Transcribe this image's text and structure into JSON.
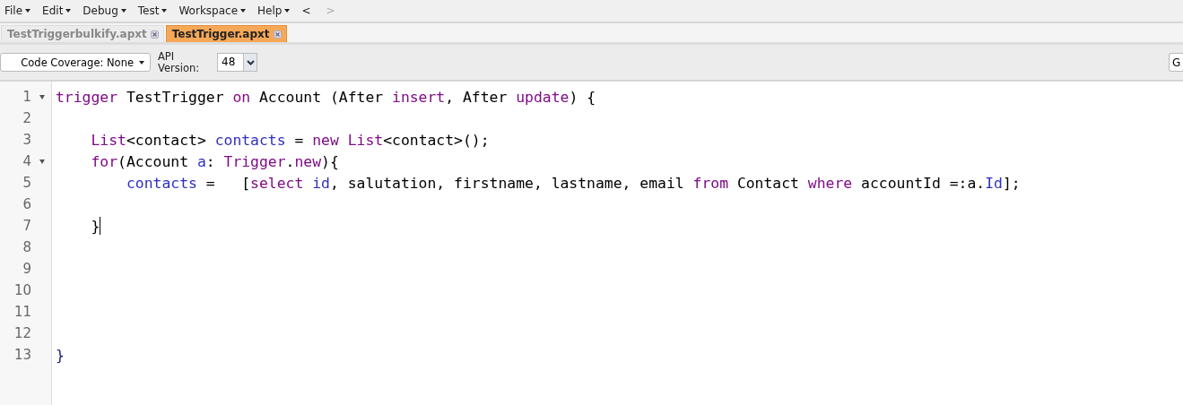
{
  "menu": [
    {
      "label": "File",
      "dropdown": true
    },
    {
      "label": "Edit",
      "dropdown": true
    },
    {
      "label": "Debug",
      "dropdown": true
    },
    {
      "label": "Test",
      "dropdown": true
    },
    {
      "label": "Workspace",
      "dropdown": true
    },
    {
      "label": "Help",
      "dropdown": true
    },
    {
      "label": "<",
      "dropdown": false,
      "disabled": false
    },
    {
      "label": ">",
      "dropdown": false,
      "disabled": true
    }
  ],
  "tabs": [
    {
      "label": "TestTriggerbulkify.apxt",
      "selected": false
    },
    {
      "label": "TestTrigger.apxt",
      "selected": true
    }
  ],
  "toolbar": {
    "coverage": "Code Coverage: None",
    "api_label": "API Version:",
    "api_version": "48",
    "right_button": "G"
  },
  "lines": [
    {
      "number": "1",
      "foldable": true,
      "tokens": [
        {
          "kind": "kw",
          "text": "trigger"
        },
        {
          "kind": "plain",
          "text": " TestTrigger "
        },
        {
          "kind": "kw",
          "text": "on"
        },
        {
          "kind": "plain",
          "text": " Account (After "
        },
        {
          "kind": "kw",
          "text": "insert"
        },
        {
          "kind": "plain",
          "text": ", After "
        },
        {
          "kind": "kw",
          "text": "update"
        },
        {
          "kind": "plain",
          "text": ") {"
        }
      ]
    },
    {
      "number": "2",
      "foldable": false
    },
    {
      "number": "3",
      "foldable": false,
      "tokens": [
        {
          "kind": "kw",
          "text": "    List"
        },
        {
          "kind": "plain",
          "text": "<contact> "
        },
        {
          "kind": "id",
          "text": "contacts"
        },
        {
          "kind": "plain",
          "text": " = "
        },
        {
          "kind": "kw",
          "text": "new List"
        },
        {
          "kind": "plain",
          "text": "<contact>();"
        }
      ]
    },
    {
      "number": "4",
      "foldable": true,
      "tokens": [
        {
          "kind": "kw",
          "text": "    for"
        },
        {
          "kind": "plain",
          "text": "(Account "
        },
        {
          "kind": "id",
          "text": "a"
        },
        {
          "kind": "plain",
          "text": ": "
        },
        {
          "kind": "kw",
          "text": "Trigger"
        },
        {
          "kind": "plain",
          "text": "."
        },
        {
          "kind": "kw",
          "text": "new"
        },
        {
          "kind": "plain",
          "text": "){"
        }
      ]
    },
    {
      "number": "5",
      "foldable": false,
      "tokens": [
        {
          "kind": "id",
          "text": "        contacts"
        },
        {
          "kind": "plain",
          "text": " =   ["
        },
        {
          "kind": "kw",
          "text": "select "
        },
        {
          "kind": "id",
          "text": "id"
        },
        {
          "kind": "plain",
          "text": ", salutation, firstname, lastname, email "
        },
        {
          "kind": "kw",
          "text": "from"
        },
        {
          "kind": "plain",
          "text": " Contact "
        },
        {
          "kind": "kw",
          "text": "where"
        },
        {
          "kind": "plain",
          "text": " accountId =:a."
        },
        {
          "kind": "id",
          "text": "Id"
        },
        {
          "kind": "plain",
          "text": "];"
        }
      ]
    },
    {
      "number": "6",
      "foldable": false
    },
    {
      "number": "7",
      "foldable": false,
      "cursor": true,
      "tokens": [
        {
          "kind": "plain",
          "text": "    }"
        }
      ]
    },
    {
      "number": "8",
      "foldable": false
    },
    {
      "number": "9",
      "foldable": false
    },
    {
      "number": "10",
      "foldable": false
    },
    {
      "number": "11",
      "foldable": false
    },
    {
      "number": "12",
      "foldable": false
    },
    {
      "number": "13",
      "foldable": false,
      "tokens": [
        {
          "kind": "brace",
          "text": "}"
        }
      ]
    }
  ]
}
